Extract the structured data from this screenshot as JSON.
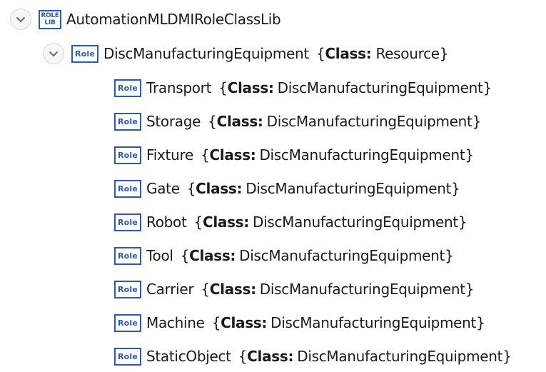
{
  "root": {
    "icon": "role-class-lib-icon",
    "icon_text_top": "ROLE",
    "icon_text_bottom": "LIB",
    "label": "AutomationMLDMIRoleClassLib"
  },
  "parent": {
    "icon": "role-icon",
    "icon_text": "Role",
    "name": "DiscManufacturingEquipment",
    "open_brace": "{",
    "class_key": "Class:",
    "class_value": "Resource",
    "close_brace": "}"
  },
  "children": [
    {
      "icon_text": "Role",
      "name": "Transport",
      "open_brace": "{",
      "class_key": "Class:",
      "class_value": "DiscManufacturingEquipment",
      "close_brace": "}"
    },
    {
      "icon_text": "Role",
      "name": "Storage",
      "open_brace": "{",
      "class_key": "Class:",
      "class_value": "DiscManufacturingEquipment",
      "close_brace": "}"
    },
    {
      "icon_text": "Role",
      "name": "Fixture",
      "open_brace": "{",
      "class_key": "Class:",
      "class_value": "DiscManufacturingEquipment",
      "close_brace": "}"
    },
    {
      "icon_text": "Role",
      "name": "Gate",
      "open_brace": "{",
      "class_key": "Class:",
      "class_value": "DiscManufacturingEquipment",
      "close_brace": "}"
    },
    {
      "icon_text": "Role",
      "name": "Robot",
      "open_brace": "{",
      "class_key": "Class:",
      "class_value": "DiscManufacturingEquipment",
      "close_brace": "}"
    },
    {
      "icon_text": "Role",
      "name": "Tool",
      "open_brace": "{",
      "class_key": "Class:",
      "class_value": "DiscManufacturingEquipment",
      "close_brace": "}"
    },
    {
      "icon_text": "Role",
      "name": "Carrier",
      "open_brace": "{",
      "class_key": "Class:",
      "class_value": "DiscManufacturingEquipment",
      "close_brace": "}"
    },
    {
      "icon_text": "Role",
      "name": "Machine",
      "open_brace": "{",
      "class_key": "Class:",
      "class_value": "DiscManufacturingEquipment",
      "close_brace": "}"
    },
    {
      "icon_text": "Role",
      "name": "StaticObject",
      "open_brace": "{",
      "class_key": "Class:",
      "class_value": "DiscManufacturingEquipment",
      "close_brace": "}"
    }
  ],
  "colors": {
    "icon_blue": "#2d58b8",
    "chevron_border": "#d7d7d7",
    "text": "#1a1a1a"
  }
}
